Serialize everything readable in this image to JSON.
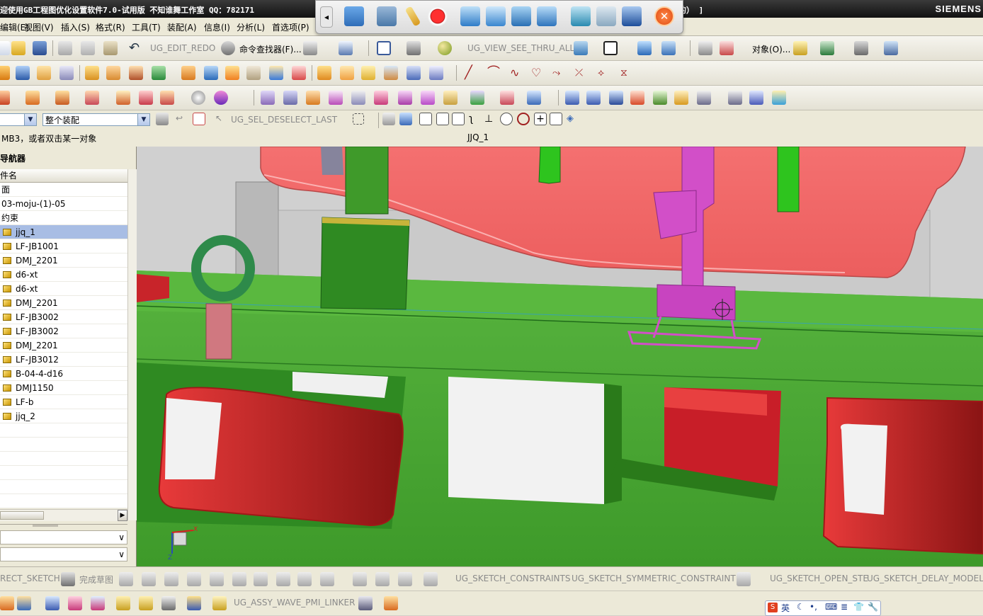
{
  "title_bar": {
    "title": "迎使用GB工程图优化设置软件7.0-试用版 不知谁舞工作室 QQ：782171",
    "title_tail": "的） ]",
    "brand": "SIEMENS"
  },
  "menu": {
    "items": [
      "编辑(E)",
      "视图(V)",
      "插入(S)",
      "格式(R)",
      "工具(T)",
      "装配(A)",
      "信息(I)",
      "分析(L)",
      "首选项(P)"
    ]
  },
  "toolbar_std": {
    "edit_redo": "UG_EDIT_REDO",
    "command_finder": "命令查找器(F)...",
    "view_see_thru": "UG_VIEW_SEE_THRU_ALL",
    "object_label": "对象(O)..."
  },
  "selection_bar": {
    "filter_value": "",
    "scope_value": "整个装配",
    "deselect_last": "UG_SEL_DESELECT_LAST"
  },
  "cue": {
    "prompt": "MB3，或者双击某一对象",
    "status": "JJQ_1"
  },
  "navigator": {
    "title": "装配导航器",
    "title_visible": "导航器",
    "column_header": "部件名",
    "column_header_visible": "件名",
    "rows": [
      {
        "label": "面",
        "icon": "none",
        "selected": false
      },
      {
        "label": "03-moju-(1)-05",
        "icon": "none",
        "selected": false
      },
      {
        "label": "约束",
        "icon": "none",
        "selected": false
      },
      {
        "label": "jjq_1",
        "icon": "part-cube",
        "selected": true
      },
      {
        "label": "LF-JB1001",
        "icon": "part-cube",
        "selected": false
      },
      {
        "label": "DMJ_2201",
        "icon": "part-cube",
        "selected": false
      },
      {
        "label": "d6-xt",
        "icon": "part-cube",
        "selected": false
      },
      {
        "label": "d6-xt",
        "icon": "part-cube",
        "selected": false
      },
      {
        "label": "DMJ_2201",
        "icon": "part-cube",
        "selected": false
      },
      {
        "label": "LF-JB3002",
        "icon": "part-cube",
        "selected": false
      },
      {
        "label": "LF-JB3002",
        "icon": "part-cube",
        "selected": false
      },
      {
        "label": "DMJ_2201",
        "icon": "part-cube",
        "selected": false
      },
      {
        "label": "LF-JB3012",
        "icon": "part-cube",
        "selected": false
      },
      {
        "label": "B-04-4-d16",
        "icon": "part-cube",
        "selected": false
      },
      {
        "label": "DMJ1150",
        "icon": "part-cube",
        "selected": false
      },
      {
        "label": "LF-b",
        "icon": "part-cube",
        "selected": false
      },
      {
        "label": "jjq_2",
        "icon": "part-cube",
        "selected": false
      }
    ]
  },
  "viewport": {
    "triad_labels": [
      "X",
      "Z"
    ]
  },
  "sketch_toolbar": {
    "direct_sketch": "RECT_SKETCH",
    "finish_sketch": "完成草图",
    "constraints": "UG_SKETCH_CONSTRAINTS",
    "symmetric": "UG_SKETCH_SYMMETRIC_CONSTRAINT",
    "open_step": "UG_SKETCH_OPEN_STE",
    "delay_model": "UG_SKETCH_DELAY_MODEL_"
  },
  "assembly_toolbar": {
    "wave_pmi": "UG_ASSY_WAVE_PMI_LINKER"
  },
  "ime": {
    "mode": "英"
  },
  "colors": {
    "title_bg": "#111111",
    "menu_bg": "#ece9d8",
    "selection_highlight": "#a8bde4",
    "model_green": "#3f9f2c",
    "model_red": "#c8242a",
    "model_pink": "#f06a6a",
    "highlight_magenta": "#d24fc8"
  }
}
